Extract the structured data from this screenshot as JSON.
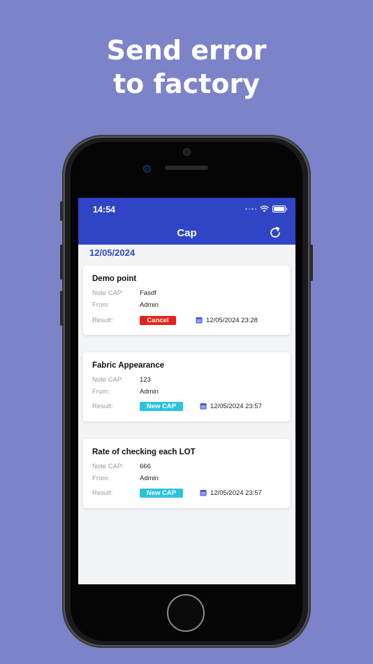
{
  "headline": {
    "line1": "Send error",
    "line2": "to factory"
  },
  "status_bar": {
    "time": "14:54"
  },
  "app_bar": {
    "title": "Cap"
  },
  "date_header": "12/05/2024",
  "labels": {
    "note": "Note CAP:",
    "from": "From:",
    "result": "Result:"
  },
  "colors": {
    "appbar": "#2f45c5",
    "cancel": "#e8221b",
    "new_cap": "#29c3e0",
    "background": "#7c83c9"
  },
  "cards": [
    {
      "title": "Demo point",
      "note": "Fasdf",
      "from": "Admin",
      "result": "Cancel",
      "timestamp": "12/05/2024 23:28"
    },
    {
      "title": "Fabric Appearance",
      "note": "123",
      "from": "Admin",
      "result": "New CAP",
      "timestamp": "12/05/2024 23:57"
    },
    {
      "title": "Rate of checking each LOT",
      "note": "666",
      "from": "Admin",
      "result": "New CAP",
      "timestamp": "12/05/2024 23:57"
    }
  ]
}
